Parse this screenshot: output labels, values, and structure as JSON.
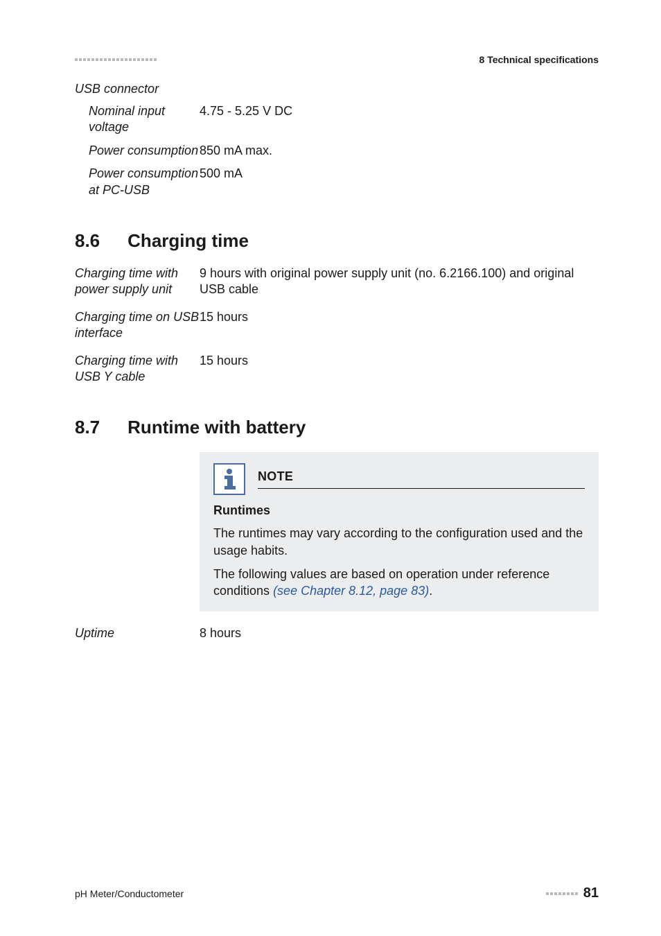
{
  "header": {
    "chapter": "8 Technical specifications"
  },
  "usb_connector": {
    "group_title": "USB connector",
    "rows": [
      {
        "label": "Nominal input voltage",
        "value": "4.75 - 5.25 V DC"
      },
      {
        "label": "Power consumption",
        "value": "850 mA max."
      },
      {
        "label": "Power consumption at PC-USB",
        "value": "500 mA"
      }
    ]
  },
  "section_8_6": {
    "num": "8.6",
    "title": "Charging time",
    "rows": [
      {
        "label": "Charging time with power supply unit",
        "value": "9 hours with original power supply unit (no. 6.2166.100) and original USB cable"
      },
      {
        "label": "Charging time on USB interface",
        "value": "15 hours"
      },
      {
        "label": "Charging time with USB Y cable",
        "value": "15 hours"
      }
    ]
  },
  "section_8_7": {
    "num": "8.7",
    "title": "Runtime with battery",
    "note": {
      "title": "NOTE",
      "subheading": "Runtimes",
      "body1": "The runtimes may vary according to the configuration used and the usage habits.",
      "body2_pre": "The following values are based on operation under reference conditions ",
      "body2_link": "(see Chapter 8.12, page 83)",
      "body2_post": "."
    },
    "uptime": {
      "label": "Uptime",
      "value": "8 hours"
    }
  },
  "footer": {
    "left": "pH Meter/Conductometer",
    "page": "81"
  }
}
